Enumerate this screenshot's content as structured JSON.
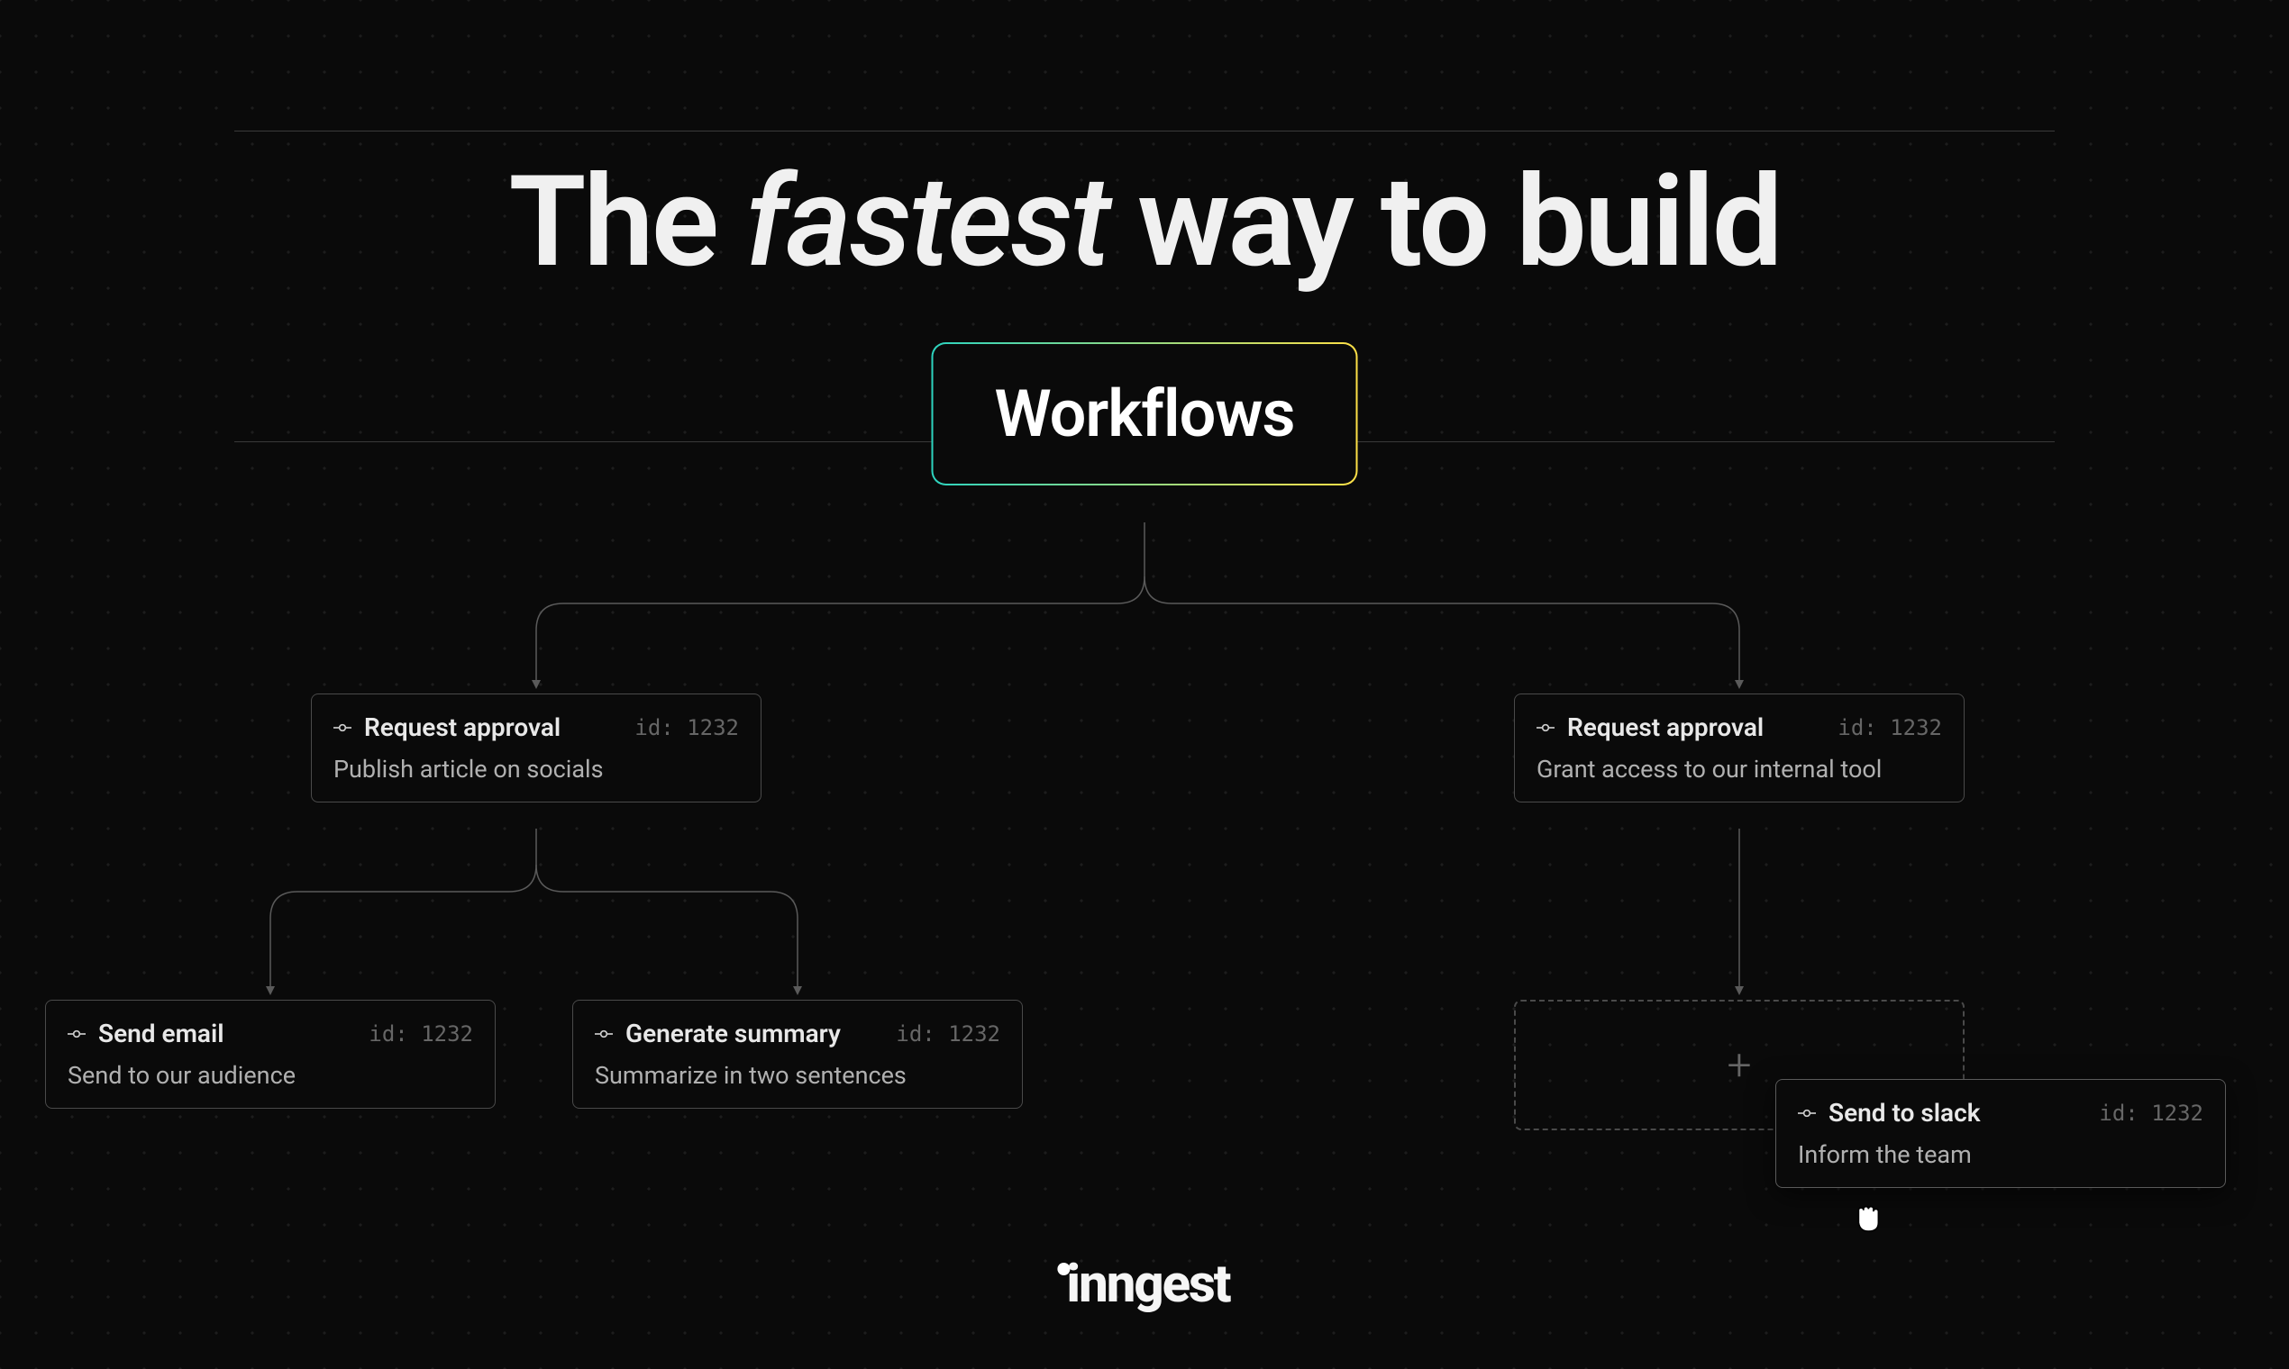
{
  "headline": {
    "pre": "The ",
    "em": "fastest",
    "post": " way to build"
  },
  "workflows_label": "Workflows",
  "nodes": {
    "left_parent": {
      "title": "Request approval",
      "id": "id: 1232",
      "desc": "Publish article on socials"
    },
    "left_child_a": {
      "title": "Send email",
      "id": "id: 1232",
      "desc": "Send to our audience"
    },
    "left_child_b": {
      "title": "Generate summary",
      "id": "id: 1232",
      "desc": "Summarize in two sentences"
    },
    "right_parent": {
      "title": "Request approval",
      "id": "id: 1232",
      "desc": "Grant access to our internal tool"
    },
    "drag": {
      "title": "Send to slack",
      "id": "id: 1232",
      "desc": "Inform the team"
    }
  },
  "dropzone_plus": "+",
  "logo_text": "inngest"
}
